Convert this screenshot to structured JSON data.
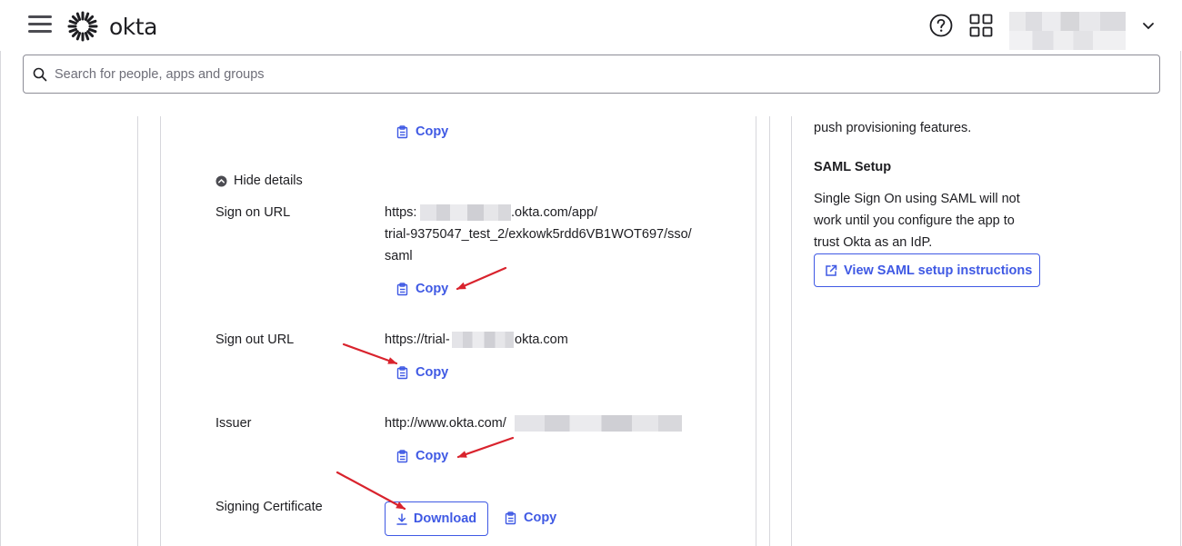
{
  "header": {
    "brand": "okta",
    "search_placeholder": "Search for people, apps and groups"
  },
  "details": {
    "copy_label": "Copy",
    "hide_details": "Hide details",
    "sign_on": {
      "label": "Sign on URL",
      "value_prefix": "https:",
      "value_line1_suffix": ".okta.com/app/",
      "value_line2": "trial-9375047_test_2/exkowk5rdd6VB1WOT697/sso/",
      "value_line3": "saml"
    },
    "sign_out": {
      "label": "Sign out URL",
      "value_prefix": "https://trial-",
      "value_suffix": "okta.com"
    },
    "issuer": {
      "label": "Issuer",
      "value_prefix": "http://www.okta.com/"
    },
    "certificate": {
      "label": "Signing Certificate",
      "download_label": "Download"
    }
  },
  "side": {
    "provisioning_text": "push provisioning features.",
    "saml_heading": "SAML Setup",
    "saml_desc_1": "Single Sign On using SAML will not",
    "saml_desc_2": "work until you configure the app to",
    "saml_desc_3": "trust Okta as an IdP.",
    "saml_button": "View SAML setup instructions"
  },
  "colors": {
    "accent": "#3f59e4",
    "annotation": "#d9232d"
  }
}
